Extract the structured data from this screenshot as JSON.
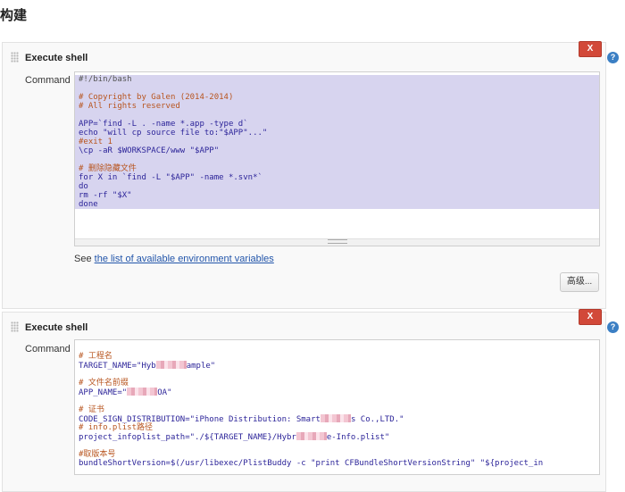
{
  "page": {
    "title": "构建"
  },
  "build_steps": [
    {
      "title": "Execute shell",
      "close_label": "X",
      "help_label": "?",
      "command_label": "Command",
      "lines": [
        {
          "t": "#!/bin/bash",
          "c": "shebang"
        },
        {
          "t": "",
          "c": "code"
        },
        {
          "t": "# Copyright by Galen (2014-2014)",
          "c": "comment"
        },
        {
          "t": "# All rights reserved",
          "c": "comment"
        },
        {
          "t": "",
          "c": "code"
        },
        {
          "t": "APP=`find -L . -name *.app -type d`",
          "c": "code"
        },
        {
          "t": "echo \"will cp source file to:\"$APP\"...\"",
          "c": "code"
        },
        {
          "t": "#exit 1",
          "c": "comment"
        },
        {
          "t": "\\cp -aR $WORKSPACE/www \"$APP\"",
          "c": "code"
        },
        {
          "t": "",
          "c": "code"
        },
        {
          "t": "# 删除隐藏文件",
          "c": "comment"
        },
        {
          "t": "for X in `find -L \"$APP\" -name *.svn*`",
          "c": "code"
        },
        {
          "t": "do",
          "c": "code"
        },
        {
          "t": "rm -rf \"$X\"",
          "c": "code"
        },
        {
          "t": "done",
          "c": "code"
        }
      ],
      "env_prefix": "See ",
      "env_link": "the list of available environment variables",
      "advanced_label": "高级..."
    },
    {
      "title": "Execute shell",
      "close_label": "X",
      "help_label": "?",
      "command_label": "Command",
      "lines": [
        {
          "t": "",
          "c": "code"
        },
        {
          "t": "# 工程名",
          "c": "comment"
        },
        {
          "t": "TARGET_NAME=\"Hyb",
          "c": "code",
          "blur": 1,
          "rest": "ample\""
        },
        {
          "t": "",
          "c": "code"
        },
        {
          "t": "# 文件名前缀",
          "c": "comment"
        },
        {
          "t": "APP_NAME=\"",
          "c": "code",
          "blur": 1,
          "rest": "OA\""
        },
        {
          "t": "",
          "c": "code"
        },
        {
          "t": "# 证书",
          "c": "comment"
        },
        {
          "t": "CODE_SIGN_DISTRIBUTION=\"iPhone Distribution: Smart",
          "c": "code",
          "blur": 1,
          "rest": "s Co.,LTD.\""
        },
        {
          "t": "# info.plist路径",
          "c": "comment"
        },
        {
          "t": "project_infoplist_path=\"./${TARGET_NAME}/Hybr",
          "c": "code",
          "blur": 1,
          "rest": "e-Info.plist\""
        },
        {
          "t": "",
          "c": "code"
        },
        {
          "t": "#取版本号",
          "c": "comment"
        },
        {
          "t": "bundleShortVersion=$(/usr/libexec/PlistBuddy -c \"print CFBundleShortVersionString\" \"${project_in",
          "c": "code"
        }
      ]
    }
  ]
}
